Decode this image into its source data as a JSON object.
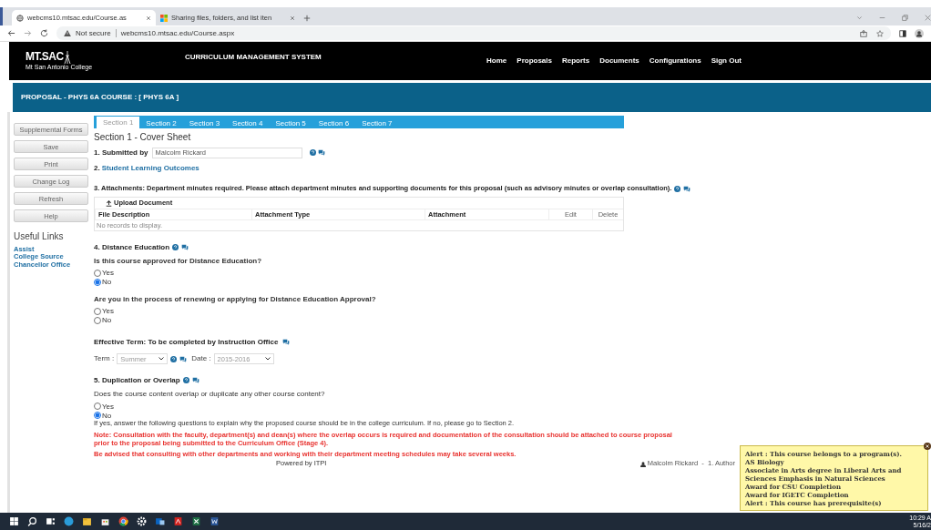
{
  "browser": {
    "tabs": [
      {
        "title": "webcms10.mtsac.edu/Course.as",
        "selected": true
      },
      {
        "title": "Sharing files, folders, and list iten",
        "selected": false
      }
    ],
    "address": {
      "security": "Not secure",
      "url": "webcms10.mtsac.edu/Course.aspx"
    }
  },
  "header": {
    "logo": "MT.SAC",
    "logo_sub": "Mt San Antonio College",
    "system_title": "CURRICULUM MANAGEMENT SYSTEM",
    "nav": [
      "Home",
      "Proposals",
      "Reports",
      "Documents",
      "Configurations",
      "Sign Out"
    ]
  },
  "banner": {
    "title": "PROPOSAL - PHYS 6A COURSE : [ PHYS 6A ]"
  },
  "sidebar": {
    "buttons": [
      "Supplemental Forms",
      "Save",
      "Print",
      "Change Log",
      "Refresh",
      "Help"
    ],
    "links_title": "Useful Links",
    "links": [
      "Assist",
      "College Source",
      "Chancellor Office"
    ]
  },
  "section_tabs": [
    {
      "label": "Section 1",
      "selected": true
    },
    {
      "label": "Section 2",
      "selected": false
    },
    {
      "label": "Section 3",
      "selected": false
    },
    {
      "label": "Section 4",
      "selected": false
    },
    {
      "label": "Section 5",
      "selected": false
    },
    {
      "label": "Section 6",
      "selected": false
    },
    {
      "label": "Section 7",
      "selected": false
    }
  ],
  "form": {
    "title": "Section 1 - Cover Sheet",
    "submitted": {
      "label": "1. Submitted by",
      "value": "Malcolm Rickard"
    },
    "slo": {
      "number": "2.",
      "link": "Student Learning Outcomes"
    },
    "attachments": {
      "label": "3. Attachments: Department minutes required. Please attach department minutes and supporting documents for this proposal (such as advisory minutes or overlap consultation).",
      "upload": "Upload Document",
      "columns": [
        "File Description",
        "Attachment Type",
        "Attachment",
        "Edit",
        "Delete"
      ],
      "empty": "No records to display."
    },
    "distance": {
      "heading": "4. Distance Education",
      "questions": [
        {
          "text": "Is this course approved for Distance Education?",
          "options": [
            {
              "label": "Yes",
              "selected": false
            },
            {
              "label": "No",
              "selected": true
            }
          ]
        },
        {
          "text": "Are you in the process of renewing or applying for Distance Education Approval?",
          "options": [
            {
              "label": "Yes",
              "selected": false
            },
            {
              "label": "No",
              "selected": false
            }
          ]
        }
      ]
    },
    "effective": {
      "heading": "Effective Term: To be completed by Instruction Office",
      "term_label": "Term :",
      "term": "Summer",
      "date_label": "Date :",
      "date": "2015-2016"
    },
    "duplication": {
      "heading": "5. Duplication or Overlap",
      "question": "Does the course content overlap or duplicate any other course content?",
      "options": [
        {
          "label": "Yes",
          "selected": false
        },
        {
          "label": "No",
          "selected": true
        }
      ],
      "instruction": "If yes, answer the following questions to explain why the proposed course should be in the college curriculum. If no, please go to Section 2.",
      "notes": [
        "Note: Consultation with the faculty, department(s) and dean(s) where the overlap occurs is required and documentation of the consultation should be attached to course proposal prior to the proposal being submitted to the Curriculum Office (Stage 4).",
        "Be advised that consulting with other departments and working with their department meeting schedules may take several weeks."
      ]
    }
  },
  "footer": {
    "powered": "Powered by ITPI",
    "author": "Malcolm Rickard  -  1. Author"
  },
  "alert": {
    "lines": [
      "Alert : This course belongs to a program(s).",
      "AS Biology",
      "Associate in Arts degree in Liberal Arts and Sciences Emphasis in Natural Sciences",
      "Award for CSU Completion",
      "Award for IGETC Completion",
      "Alert : This course has prerequisite(s)"
    ]
  },
  "taskbar": {
    "time": "10:29 A",
    "date": "5/16/2"
  }
}
